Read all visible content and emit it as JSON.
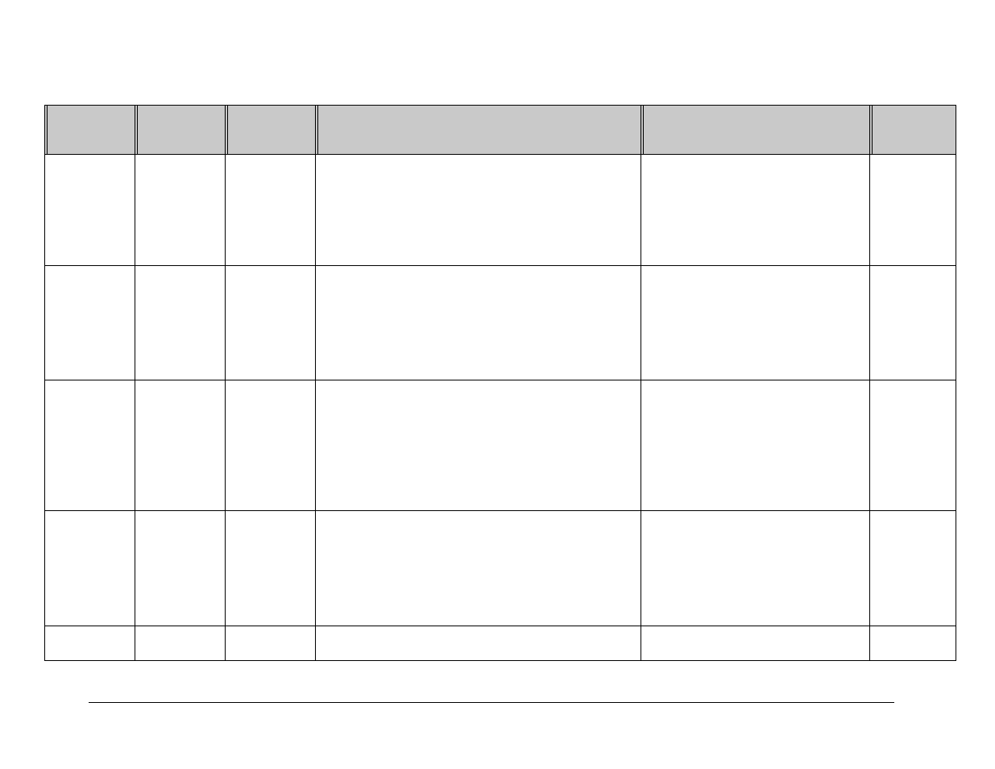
{
  "table": {
    "columns": 6,
    "headers": [
      "",
      "",
      "",
      "",
      "",
      ""
    ],
    "rows": [
      [
        "",
        "",
        "",
        "",
        "",
        ""
      ],
      [
        "",
        "",
        "",
        "",
        "",
        ""
      ],
      [
        "",
        "",
        "",
        "",
        "",
        ""
      ],
      [
        "",
        "",
        "",
        "",
        "",
        ""
      ],
      [
        "",
        "",
        "",
        "",
        "",
        ""
      ]
    ]
  }
}
